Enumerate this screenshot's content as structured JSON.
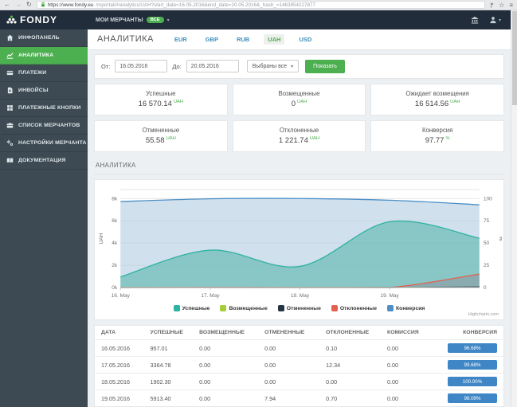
{
  "browser": {
    "url_secure": "https://www.fondy.eu",
    "url_path": "/mportal/#/analytics/UAH?start_date=16.05.2016&end_date=20.05.2016&_hash_=1463954227877"
  },
  "icons": {
    "back": "←",
    "forward": "→",
    "reload": "↻",
    "star": "☆",
    "menu": "≡",
    "caret": "▾"
  },
  "navbar": {
    "brand": "FONDY",
    "merchants_label": "МОИ МЕРЧАНТЫ",
    "merchants_badge": "ВСЕ"
  },
  "sidebar": {
    "items": [
      {
        "key": "dashboard",
        "label": "ИНФОПАНЕЛЬ",
        "icon": "home-icon",
        "active": false
      },
      {
        "key": "analytics",
        "label": "АНАЛИТИКА",
        "icon": "analytics-icon",
        "active": true
      },
      {
        "key": "payments",
        "label": "ПЛАТЕЖИ",
        "icon": "credit-card-icon",
        "active": false
      },
      {
        "key": "invoices",
        "label": "ИНВОЙСЫ",
        "icon": "invoice-icon",
        "active": false
      },
      {
        "key": "payment-buttons",
        "label": "ПЛАТЕЖНЫЕ КНОПКИ",
        "icon": "keypad-icon",
        "active": false
      },
      {
        "key": "merchant-list",
        "label": "СПИСОК МЕРЧАНТОВ",
        "icon": "briefcase-icon",
        "active": false
      },
      {
        "key": "merchant-settings",
        "label": "НАСТРОЙКИ МЕРЧАНТА",
        "icon": "gears-icon",
        "active": false
      },
      {
        "key": "documentation",
        "label": "ДОКУМЕНТАЦИЯ",
        "icon": "book-icon",
        "active": false
      }
    ]
  },
  "page": {
    "title": "АНАЛИТИКА"
  },
  "currency_tabs": [
    {
      "key": "eur",
      "label": "EUR",
      "active": false
    },
    {
      "key": "gbp",
      "label": "GBP",
      "active": false
    },
    {
      "key": "rub",
      "label": "RUB",
      "active": false
    },
    {
      "key": "uah",
      "label": "UAH",
      "active": true
    },
    {
      "key": "usd",
      "label": "USD",
      "active": false
    }
  ],
  "filters": {
    "from_label": "От:",
    "from_value": "16.05.2016",
    "to_label": "До:",
    "to_value": "20.05.2016",
    "merchants_value": "Выбраны все",
    "show_label": "Показать"
  },
  "stats": [
    {
      "label": "Успешные",
      "value": "16 570.14",
      "unit": "UAH"
    },
    {
      "label": "Возмещенные",
      "value": "0",
      "unit": "UAH"
    },
    {
      "label": "Ожидает возмещения",
      "value": "16 514.56",
      "unit": "UAH"
    },
    {
      "label": "Отмененные",
      "value": "55.58",
      "unit": "UAH"
    },
    {
      "label": "Отклоненные",
      "value": "1 221.74",
      "unit": "UAH"
    },
    {
      "label": "Конверсия",
      "value": "97.77",
      "unit": "%"
    }
  ],
  "chart_panel": {
    "title": "АНАЛИТИКА",
    "credit": "Highcharts.com"
  },
  "chart_data": {
    "type": "area",
    "x_labels": [
      "16. May",
      "17. May",
      "18. May",
      "19. May",
      ""
    ],
    "yaxis_left": {
      "title": "UAH",
      "ticks": [
        "0k",
        "2k",
        "4k",
        "6k",
        "8k"
      ],
      "tick_values": [
        0,
        2000,
        4000,
        6000,
        8000
      ],
      "max": 8800
    },
    "yaxis_right": {
      "title": "%",
      "ticks": [
        "0",
        "25",
        "50",
        "75",
        "100"
      ],
      "tick_values": [
        0,
        25,
        50,
        75,
        100
      ],
      "max": 110
    },
    "grid": true,
    "legend_position": "bottom",
    "series": [
      {
        "name": "Успешные",
        "axis": "left",
        "type": "area",
        "color": "#2fb3a3",
        "fill": "rgba(88,181,172,0.6)",
        "z": 2,
        "values": [
          957.01,
          3364.78,
          1902.3,
          5913.4,
          4432.65
        ]
      },
      {
        "name": "Возмещенные",
        "axis": "left",
        "type": "line",
        "color": "#a5cd39",
        "fill": "none",
        "z": 3,
        "values": [
          0,
          0,
          0,
          0,
          0
        ]
      },
      {
        "name": "Отмененные",
        "axis": "left",
        "type": "area",
        "color": "#253544",
        "fill": "rgba(37,53,68,0.75)",
        "z": 5,
        "values": [
          0,
          0,
          0,
          7.94,
          47.64
        ]
      },
      {
        "name": "Отклоненные",
        "axis": "left",
        "type": "area",
        "color": "#e4604f",
        "fill": "rgba(140,150,158,0.55)",
        "z": 4,
        "values": [
          0.1,
          12.34,
          0.0,
          0.7,
          1208.6
        ]
      },
      {
        "name": "Конверсия",
        "axis": "right",
        "type": "area",
        "color": "#4e8fc7",
        "fill": "rgba(170,198,222,0.55)",
        "z": 1,
        "values": [
          96.68,
          99.68,
          100.0,
          98.09,
          93.0
        ]
      }
    ]
  },
  "table": {
    "headers": [
      "ДАТА",
      "УСПЕШНЫЕ",
      "ВОЗМЕЩЕННЫЕ",
      "ОТМЕНЕННЫЕ",
      "ОТКЛОНЕННЫЕ",
      "КОМИССИЯ",
      "КОНВЕРСИЯ"
    ],
    "rows": [
      {
        "date": "16.05.2016",
        "success": "957.01",
        "refunded": "0.00",
        "reversed": "0.00",
        "declined": "0.10",
        "fee": "0.00",
        "conversion": "96.68%"
      },
      {
        "date": "17.05.2016",
        "success": "3364.78",
        "refunded": "0.00",
        "reversed": "0.00",
        "declined": "12.34",
        "fee": "0.00",
        "conversion": "99.68%"
      },
      {
        "date": "18.05.2016",
        "success": "1902.30",
        "refunded": "0.00",
        "reversed": "0.00",
        "declined": "0.00",
        "fee": "0.00",
        "conversion": "100.00%"
      },
      {
        "date": "19.05.2016",
        "success": "5913.40",
        "refunded": "0.00",
        "reversed": "7.94",
        "declined": "0.70",
        "fee": "0.00",
        "conversion": "98.09%"
      }
    ]
  },
  "colors": {
    "accent_green": "#4caf50",
    "link_blue": "#3d8eb9",
    "badge_blue": "#3f86c6",
    "navbar_bg": "#222d3b",
    "sidebar_bg": "#3d4a53"
  }
}
